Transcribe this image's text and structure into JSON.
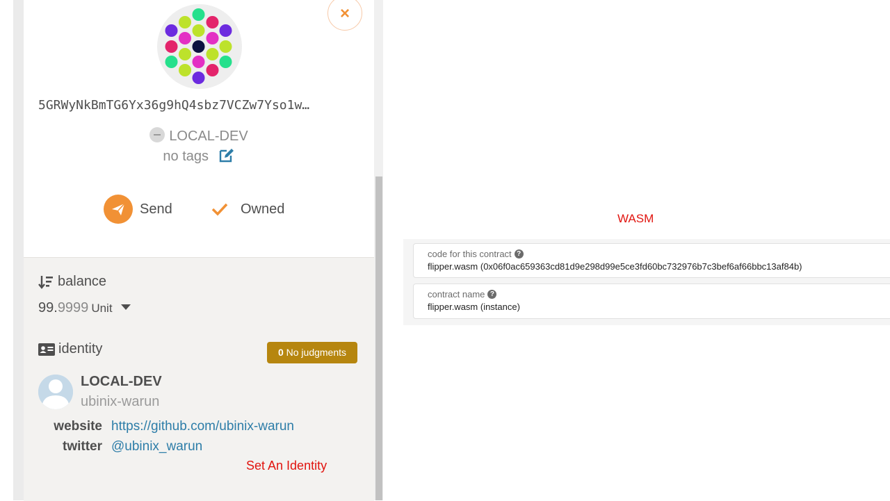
{
  "sidebar": {
    "close_symbol": "×",
    "address": "5GRWyNkBmTG6Yx36g9hQ4sbz7VCZw7Yso1w…",
    "network": "LOCAL-DEV",
    "tags": "no tags",
    "actions": {
      "send_label": "Send",
      "owned_label": "Owned"
    },
    "balance": {
      "title": "balance",
      "whole": "99.",
      "fraction": "9999",
      "unit": "Unit"
    },
    "identity": {
      "title": "identity",
      "judgment_count": "0",
      "judgment_text": "No judgments",
      "display_name": "LOCAL-DEV",
      "legal_name": "ubinix-warun",
      "website_label": "website",
      "website_value": "https://github.com/ubinix-warun",
      "twitter_label": "twitter",
      "twitter_value": "@ubinix_warun",
      "set_identity": "Set An Identity"
    }
  },
  "main": {
    "wasm_label": "WASM",
    "code_field": {
      "label": "code for this contract",
      "value": "flipper.wasm (0x06f0ac659363cd81d9e298d99e5ce3fd60bc732976b7c3bef6af66bbc13af84b)"
    },
    "name_field": {
      "label": "contract name",
      "value": "flipper.wasm (instance)"
    }
  },
  "colors": {
    "accent": "#f19135",
    "judgment_badge": "#b6860f",
    "link": "#2d7da8",
    "alert_text": "#e1140f"
  },
  "icons": [
    "close-icon",
    "identicon",
    "network-icon",
    "edit-icon",
    "send-icon",
    "check-icon",
    "sort-icon",
    "chevron-down-icon",
    "id-card-icon",
    "user-avatar-icon",
    "help-icon"
  ]
}
